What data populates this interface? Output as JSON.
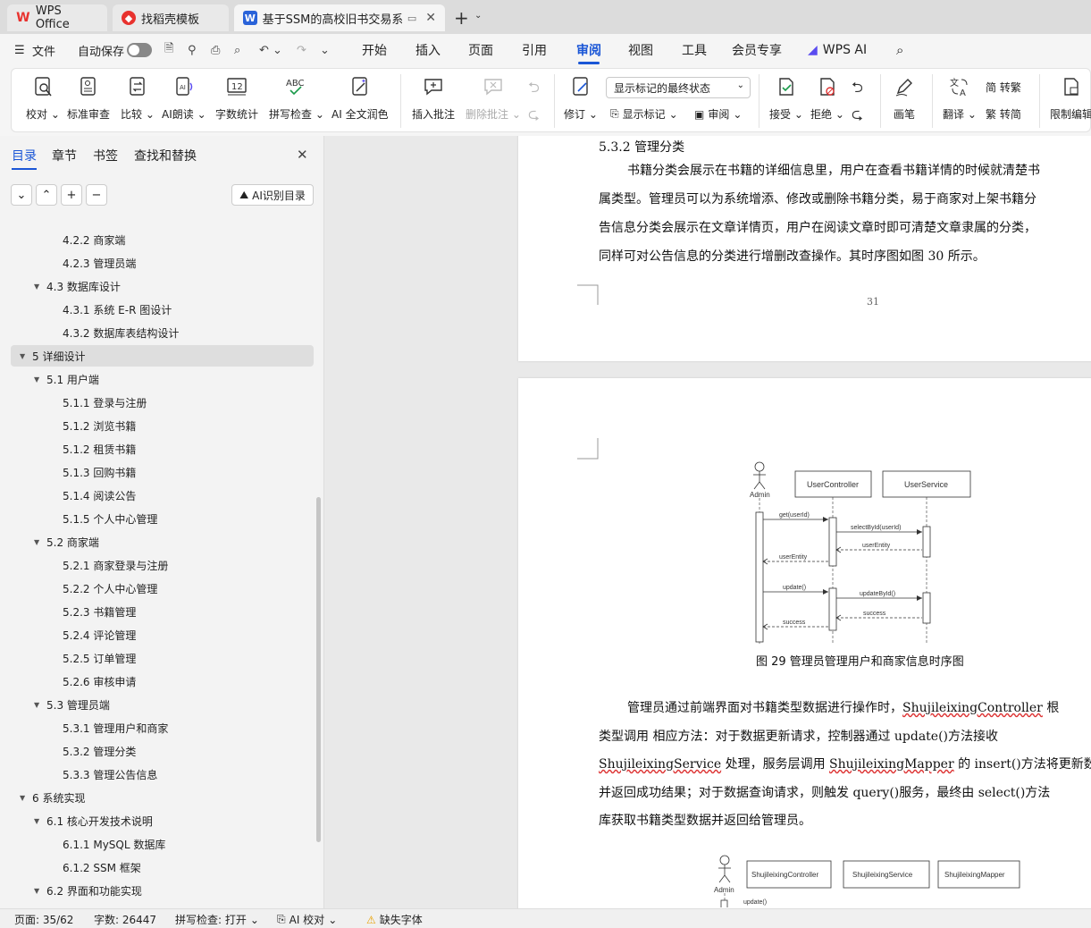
{
  "tabs": [
    {
      "label": "WPS Office",
      "icon": "wps-logo-icon"
    },
    {
      "label": "找稻壳模板",
      "icon": "docer-logo-icon"
    },
    {
      "label": "基于SSM的高校旧书交易系统",
      "icon": "word-doc-icon"
    }
  ],
  "menu": {
    "file": "文件",
    "autosave": "自动保存",
    "tabs": [
      "开始",
      "插入",
      "页面",
      "引用",
      "审阅",
      "视图",
      "工具",
      "会员专享"
    ],
    "selected_tab": "审阅",
    "wps_ai": "WPS AI"
  },
  "ribbon": {
    "proofread": "校对",
    "standard_review": "标准审查",
    "compare": "比较",
    "ai_read": "AI朗读",
    "word_count": "字数统计",
    "spell_check": "拼写检查",
    "ai_polish": "AI 全文润色",
    "insert_comment": "插入批注",
    "delete_comment": "删除批注",
    "track_changes": "修订",
    "markup_state": "显示标记的最终状态",
    "show_markup": "显示标记",
    "review": "审阅",
    "accept": "接受",
    "reject": "拒绝",
    "pen": "画笔",
    "translate": "翻译",
    "trad_simp": "简 转繁",
    "simp_trad": "繁 转简",
    "restrict_edit": "限制编辑"
  },
  "sidebar": {
    "tabs": [
      "目录",
      "章节",
      "书签",
      "查找和替换"
    ],
    "ai_toc": "AI识别目录",
    "toc": [
      {
        "text": "4.2.2  商家端",
        "level": 3
      },
      {
        "text": "4.2.3  管理员端",
        "level": 3
      },
      {
        "text": "4.3  数据库设计",
        "level": 2
      },
      {
        "text": "4.3.1  系统 E-R 图设计",
        "level": 3
      },
      {
        "text": "4.3.2  数据库表结构设计",
        "level": 3
      },
      {
        "text": "5  详细设计",
        "level": 1
      },
      {
        "text": "5.1  用户端",
        "level": 2
      },
      {
        "text": "5.1.1  登录与注册",
        "level": 3
      },
      {
        "text": "5.1.2  浏览书籍",
        "level": 3
      },
      {
        "text": "5.1.2  租赁书籍",
        "level": 3
      },
      {
        "text": "5.1.3  回购书籍",
        "level": 3
      },
      {
        "text": "5.1.4  阅读公告",
        "level": 3
      },
      {
        "text": "5.1.5  个人中心管理",
        "level": 3
      },
      {
        "text": "5.2  商家端",
        "level": 2
      },
      {
        "text": "5.2.1  商家登录与注册",
        "level": 3
      },
      {
        "text": "5.2.2  个人中心管理",
        "level": 3
      },
      {
        "text": "5.2.3  书籍管理",
        "level": 3
      },
      {
        "text": "5.2.4  评论管理",
        "level": 3
      },
      {
        "text": "5.2.5  订单管理",
        "level": 3
      },
      {
        "text": "5.2.6  审核申请",
        "level": 3
      },
      {
        "text": "5.3  管理员端",
        "level": 2
      },
      {
        "text": "5.3.1  管理用户和商家",
        "level": 3
      },
      {
        "text": "5.3.2  管理分类",
        "level": 3
      },
      {
        "text": "5.3.3  管理公告信息",
        "level": 3
      },
      {
        "text": "6  系统实现",
        "level": 1
      },
      {
        "text": "6.1  核心开发技术说明",
        "level": 2
      },
      {
        "text": "6.1.1 MySQL 数据库",
        "level": 3
      },
      {
        "text": "6.1.2 SSM 框架",
        "level": 3
      },
      {
        "text": "6.2  界面和功能实现",
        "level": 2
      }
    ],
    "selected_index": 5
  },
  "document": {
    "page1": {
      "heading": "5.3.2  管理分类",
      "lines": [
        "书籍分类会展示在书籍的详细信息里，用户在查看书籍详情的时候就清楚书",
        "属类型。管理员可以为系统增添、修改或删除书籍分类，易于商家对上架书籍分",
        "告信息分类会展示在文章详情页，用户在阅读文章时即可清楚文章隶属的分类，",
        "同样可对公告信息的分类进行增删改查操作。其时序图如图 30 所示。"
      ],
      "page_number": "31"
    },
    "diagram1": {
      "actor": "Admin",
      "objects": [
        "UserController",
        "UserService"
      ],
      "messages": [
        "get(userId)",
        "selectById(userId)",
        "userEntity",
        "userEntity",
        "update()",
        "updateById()",
        "success",
        "success"
      ],
      "caption": "图 29  管理员管理用户和商家信息时序图"
    },
    "para2": {
      "l1a": "管理员通过前端界面对书籍类型数据进行操作时，",
      "l1b": "ShujileixingController",
      "l1c": " 根",
      "l2": "类型调用 相应方法：对于数据更新请求，控制器通过 update()方法接收",
      "l3a": "ShujileixingService",
      "l3b": " 处理，服务层调用 ",
      "l3c": "ShujileixingMapper",
      "l3d": " 的 insert()方法将更新数据",
      "l4": "并返回成功结果；对于数据查询请求，则触发 query()服务，最终由 select()方法",
      "l5": "库获取书籍类型数据并返回给管理员。"
    },
    "diagram2": {
      "actor": "Admin",
      "objects": [
        "ShujileixingController",
        "ShujileixingService",
        "ShujileixingMapper"
      ],
      "message": "update()"
    }
  },
  "statusbar": {
    "page": "页面: 35/62",
    "words": "字数: 26447",
    "spell": "拼写检查: 打开",
    "ai_check": "AI 校对",
    "missing_font": "缺失字体"
  },
  "colors": {
    "accent": "#1a56d6",
    "wps_red": "#e8322e"
  }
}
